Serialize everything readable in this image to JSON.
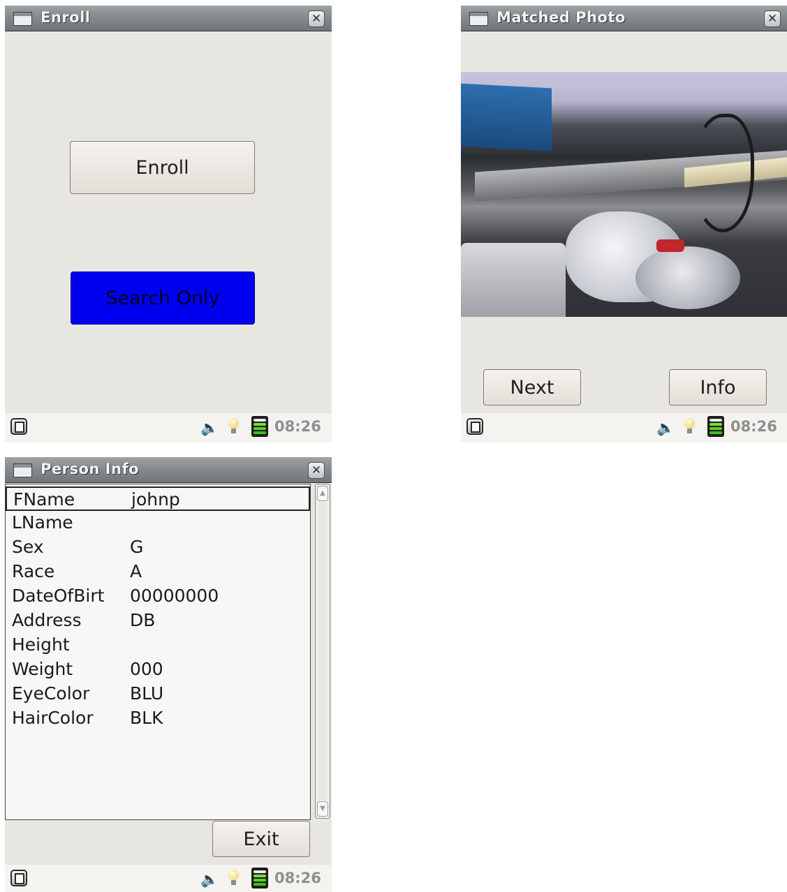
{
  "windows": {
    "enroll": {
      "title": "Enroll",
      "enroll_button": "Enroll",
      "search_button": "Search Only",
      "clock": "08:26",
      "icons": [
        "window-icon",
        "close-icon",
        "home-icon",
        "speaker-icon",
        "bulb-icon",
        "battery-icon"
      ]
    },
    "matched": {
      "title": "Matched Photo",
      "next_button": "Next",
      "info_button": "Info",
      "clock": "08:26",
      "photo": "matched-photo"
    },
    "person": {
      "title": "Person Info",
      "rows": [
        {
          "key": "FName",
          "value": "johnp"
        },
        {
          "key": "LName",
          "value": ""
        },
        {
          "key": "Sex",
          "value": "G"
        },
        {
          "key": "Race",
          "value": "A"
        },
        {
          "key": "DateOfBirt",
          "value": "00000000"
        },
        {
          "key": "Address",
          "value": "DB"
        },
        {
          "key": "Height",
          "value": ""
        },
        {
          "key": "Weight",
          "value": "000"
        },
        {
          "key": "EyeColor",
          "value": "BLU"
        },
        {
          "key": "HairColor",
          "value": "BLK"
        }
      ],
      "exit_button": "Exit",
      "clock": "08:26"
    }
  },
  "colors": {
    "window_bg": "#e8e6e1",
    "selected_button": "#0000f0",
    "titlebar": "#858b8e",
    "clock_text": "#8f8f8f"
  }
}
